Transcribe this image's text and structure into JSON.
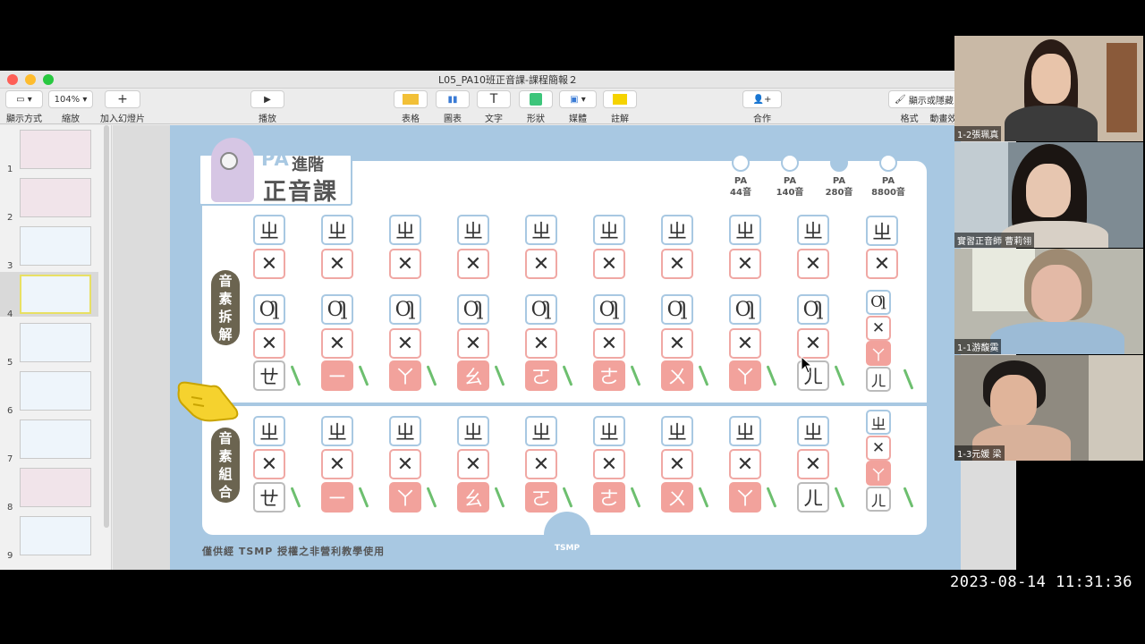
{
  "window": {
    "title": "L05_PA10班正音課-課程簡報２"
  },
  "toolbar": {
    "view": "顯示方式",
    "zoom_value": "104%",
    "zoom": "縮放",
    "add_slide": "加入幻燈片",
    "play": "播放",
    "table": "表格",
    "chart": "圖表",
    "text": "文字",
    "shape": "形狀",
    "media": "媒體",
    "comment": "註解",
    "collaborate": "合作",
    "format_btn": "顯示或隱藏",
    "format": "格式",
    "animate": "動畫效"
  },
  "sidebar": {
    "slides": [
      "1",
      "2",
      "3",
      "4",
      "5",
      "6",
      "7",
      "8",
      "9"
    ],
    "active": "4"
  },
  "slide": {
    "logo_pa": "PA",
    "logo_adv": "進階",
    "logo_main": "正音課",
    "stages": [
      {
        "label1": "PA",
        "label2": "44音"
      },
      {
        "label1": "PA",
        "label2": "140音"
      },
      {
        "label1": "PA",
        "label2": "280音"
      },
      {
        "label1": "PA",
        "label2": "8800音"
      }
    ],
    "section_decompose": [
      "音",
      "素",
      "拆",
      "解"
    ],
    "section_combine": [
      "音",
      "素",
      "組",
      "合"
    ],
    "zh": "ㄓ",
    "x_tile": "✕",
    "q_tile": "Ƣ",
    "endings": [
      "ㄝ",
      "ㄧ",
      "ㄚ",
      "ㄠ",
      "ㄛ",
      "ㄜ",
      "ㄨ",
      "ㄚ",
      "ㄦ"
    ],
    "last_col_ending": "ㄦ",
    "tsmp": "TSMP",
    "footer": "僅供經 TSMP 授權之非營利教學使用"
  },
  "participants": [
    {
      "name": "1-2張珮真"
    },
    {
      "name": "實習正音師 曹莉翎"
    },
    {
      "name": "1-1游馥霙"
    },
    {
      "name": "1-3元媛 梁"
    }
  ],
  "timestamp": "2023-08-14 11:31:36"
}
